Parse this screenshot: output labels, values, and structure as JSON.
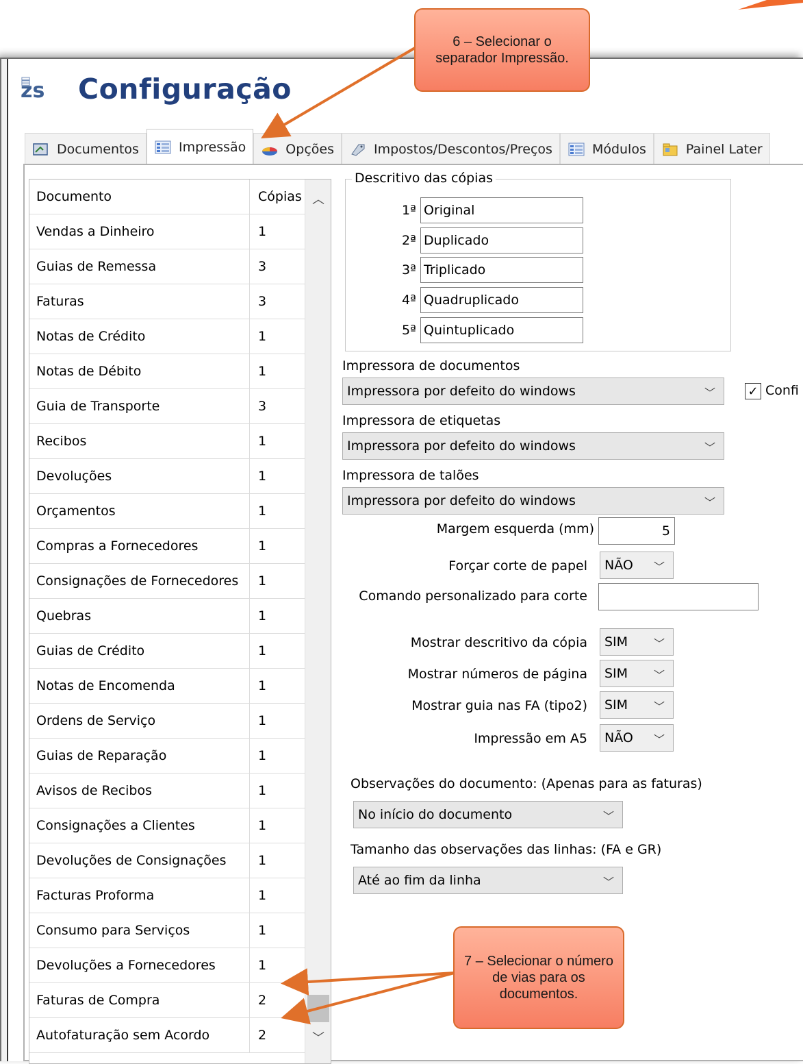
{
  "window": {
    "logo": "zs",
    "title": "Configuração"
  },
  "tabs": [
    {
      "label": "Documentos",
      "icon": "documents-icon"
    },
    {
      "label": "Impressão",
      "icon": "list-icon",
      "active": true
    },
    {
      "label": "Opções",
      "icon": "chart-icon"
    },
    {
      "label": "Impostos/Descontos/Preços",
      "icon": "tag-icon"
    },
    {
      "label": "Módulos",
      "icon": "list-icon"
    },
    {
      "label": "Painel Later",
      "icon": "folder-icon"
    }
  ],
  "documents_table": {
    "headers": {
      "document": "Documento",
      "copies": "Cópias"
    },
    "rows": [
      {
        "name": "Vendas a Dinheiro",
        "copies": "1"
      },
      {
        "name": "Guias de Remessa",
        "copies": "3"
      },
      {
        "name": "Faturas",
        "copies": "3"
      },
      {
        "name": "Notas de Crédito",
        "copies": "1"
      },
      {
        "name": "Notas de Débito",
        "copies": "1"
      },
      {
        "name": "Guia de Transporte",
        "copies": "3"
      },
      {
        "name": "Recibos",
        "copies": "1"
      },
      {
        "name": "Devoluções",
        "copies": "1"
      },
      {
        "name": "Orçamentos",
        "copies": "1"
      },
      {
        "name": "Compras a Fornecedores",
        "copies": "1"
      },
      {
        "name": "Consignações de Fornecedores",
        "copies": "1"
      },
      {
        "name": "Quebras",
        "copies": "1"
      },
      {
        "name": "Guias de Crédito",
        "copies": "1"
      },
      {
        "name": "Notas de Encomenda",
        "copies": "1"
      },
      {
        "name": "Ordens de Serviço",
        "copies": "1"
      },
      {
        "name": "Guias de Reparação",
        "copies": "1"
      },
      {
        "name": "Avisos de Recibos",
        "copies": "1"
      },
      {
        "name": "Consignações a Clientes",
        "copies": "1"
      },
      {
        "name": "Devoluções de Consignações",
        "copies": "1"
      },
      {
        "name": "Facturas Proforma",
        "copies": "1"
      },
      {
        "name": "Consumo para Serviços",
        "copies": "1"
      },
      {
        "name": "Devoluções a Fornecedores",
        "copies": "1"
      },
      {
        "name": "Faturas de Compra",
        "copies": "2"
      },
      {
        "name": "Autofaturação sem Acordo",
        "copies": "2"
      }
    ]
  },
  "copies_desc": {
    "legend": "Descritivo das cópias",
    "items": [
      {
        "ord": "1ª",
        "value": "Original"
      },
      {
        "ord": "2ª",
        "value": "Duplicado"
      },
      {
        "ord": "3ª",
        "value": "Triplicado"
      },
      {
        "ord": "4ª",
        "value": "Quadruplicado"
      },
      {
        "ord": "5ª",
        "value": "Quintuplicado"
      }
    ]
  },
  "printers": {
    "documents_label": "Impressora de documentos",
    "documents_value": "Impressora por defeito do windows",
    "confirm_label": "Confi",
    "confirm_checked": true,
    "labels_label": "Impressora de etiquetas",
    "labels_value": "Impressora por defeito do windows",
    "tickets_label": "Impressora de talões",
    "tickets_value": "Impressora por defeito do windows"
  },
  "options": {
    "left_margin_label": "Margem esquerda (mm)",
    "left_margin_value": "5",
    "force_cut_label": "Forçar corte de papel",
    "force_cut_value": "NÃO",
    "custom_cut_label": "Comando personalizado para corte",
    "custom_cut_value": "",
    "show_copy_desc_label": "Mostrar descritivo da cópia",
    "show_copy_desc_value": "SIM",
    "show_page_numbers_label": "Mostrar números de página",
    "show_page_numbers_value": "SIM",
    "show_guide_label": "Mostrar guia nas FA (tipo2)",
    "show_guide_value": "SIM",
    "print_a5_label": "Impressão em A5",
    "print_a5_value": "NÃO"
  },
  "observations": {
    "doc_label": "Observações do documento: (Apenas para as faturas)",
    "doc_value": "No início do documento",
    "lines_label": "Tamanho das observações das linhas: (FA e GR)",
    "lines_value": "Até ao fim da linha"
  },
  "callouts": {
    "step6": "6 – Selecionar o separador Impressão.",
    "step7": "7 – Selecionar o número de vias para os documentos."
  },
  "colors": {
    "title": "#22407d",
    "callout_fill": "#f77e62",
    "callout_border": "#d86a2b",
    "arrow": "#e0702a"
  }
}
